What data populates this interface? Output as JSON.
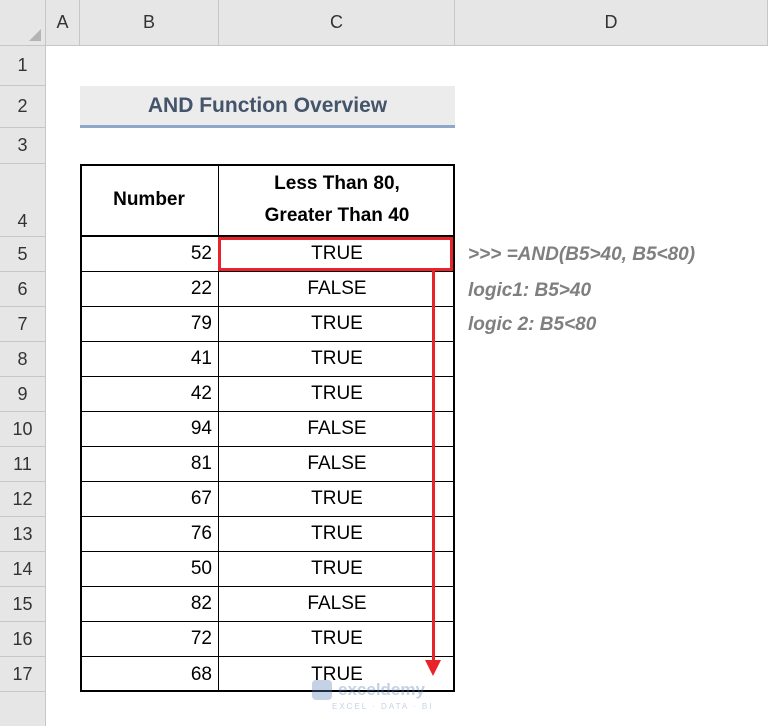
{
  "columns": [
    "A",
    "B",
    "C",
    "D"
  ],
  "rows": [
    "1",
    "2",
    "3",
    "4",
    "5",
    "6",
    "7",
    "8",
    "9",
    "10",
    "11",
    "12",
    "13",
    "14",
    "15",
    "16",
    "17"
  ],
  "title": "AND Function Overview",
  "table": {
    "header_b": "Number",
    "header_c_line1": "Less Than 80,",
    "header_c_line2": "Greater Than 40",
    "data": [
      {
        "number": "52",
        "result": "TRUE"
      },
      {
        "number": "22",
        "result": "FALSE"
      },
      {
        "number": "79",
        "result": "TRUE"
      },
      {
        "number": "41",
        "result": "TRUE"
      },
      {
        "number": "42",
        "result": "TRUE"
      },
      {
        "number": "94",
        "result": "FALSE"
      },
      {
        "number": "81",
        "result": "FALSE"
      },
      {
        "number": "67",
        "result": "TRUE"
      },
      {
        "number": "76",
        "result": "TRUE"
      },
      {
        "number": "50",
        "result": "TRUE"
      },
      {
        "number": "82",
        "result": "FALSE"
      },
      {
        "number": "72",
        "result": "TRUE"
      },
      {
        "number": "68",
        "result": "TRUE"
      }
    ]
  },
  "notes": {
    "formula": ">>>  =AND(B5>40, B5<80)",
    "logic1": "logic1: B5>40",
    "logic2": "logic 2: B5<80"
  },
  "watermark": {
    "brand": "exceldemy",
    "tagline": "EXCEL · DATA · BI"
  },
  "colors": {
    "highlight": "#e8232a",
    "title_text": "#44546a",
    "title_underline": "#8ea9c8",
    "note_text": "#7f7f7f"
  }
}
